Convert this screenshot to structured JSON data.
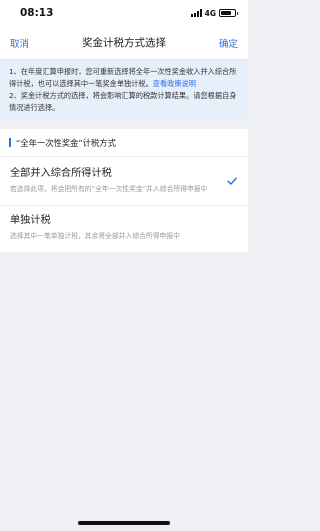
{
  "status_bar": {
    "time": "08:13",
    "network": "4G"
  },
  "nav": {
    "cancel_label": "取消",
    "title": "奖金计税方式选择",
    "confirm_label": "确定"
  },
  "notice": {
    "line1_text": "1、在年度汇算申报时，您可重新选择将全年一次性奖金收入并入综合所得计税，也可以选择其中一笔奖金单独计税。",
    "line1_link": "查看政策说明",
    "line2_text": "2、奖金计税方式的选择，将会影响汇算的税款计算结果。请您根据自身情况进行选择。"
  },
  "section": {
    "title": "“全年一次性奖金”计税方式"
  },
  "options": [
    {
      "title": "全部并入综合所得计税",
      "desc": "若选择此项，将会把所有的“全年一次性奖金”并入综合所得申报中",
      "selected": true
    },
    {
      "title": "单独计税",
      "desc": "选择其中一笔单独计税，其余将全部并入综合所得申报中",
      "selected": false
    }
  ],
  "colors": {
    "accent": "#2f6fe4",
    "notice_bg": "#e7effb",
    "page_bg": "#eef0f4"
  },
  "icons": {
    "check": "check-icon"
  }
}
